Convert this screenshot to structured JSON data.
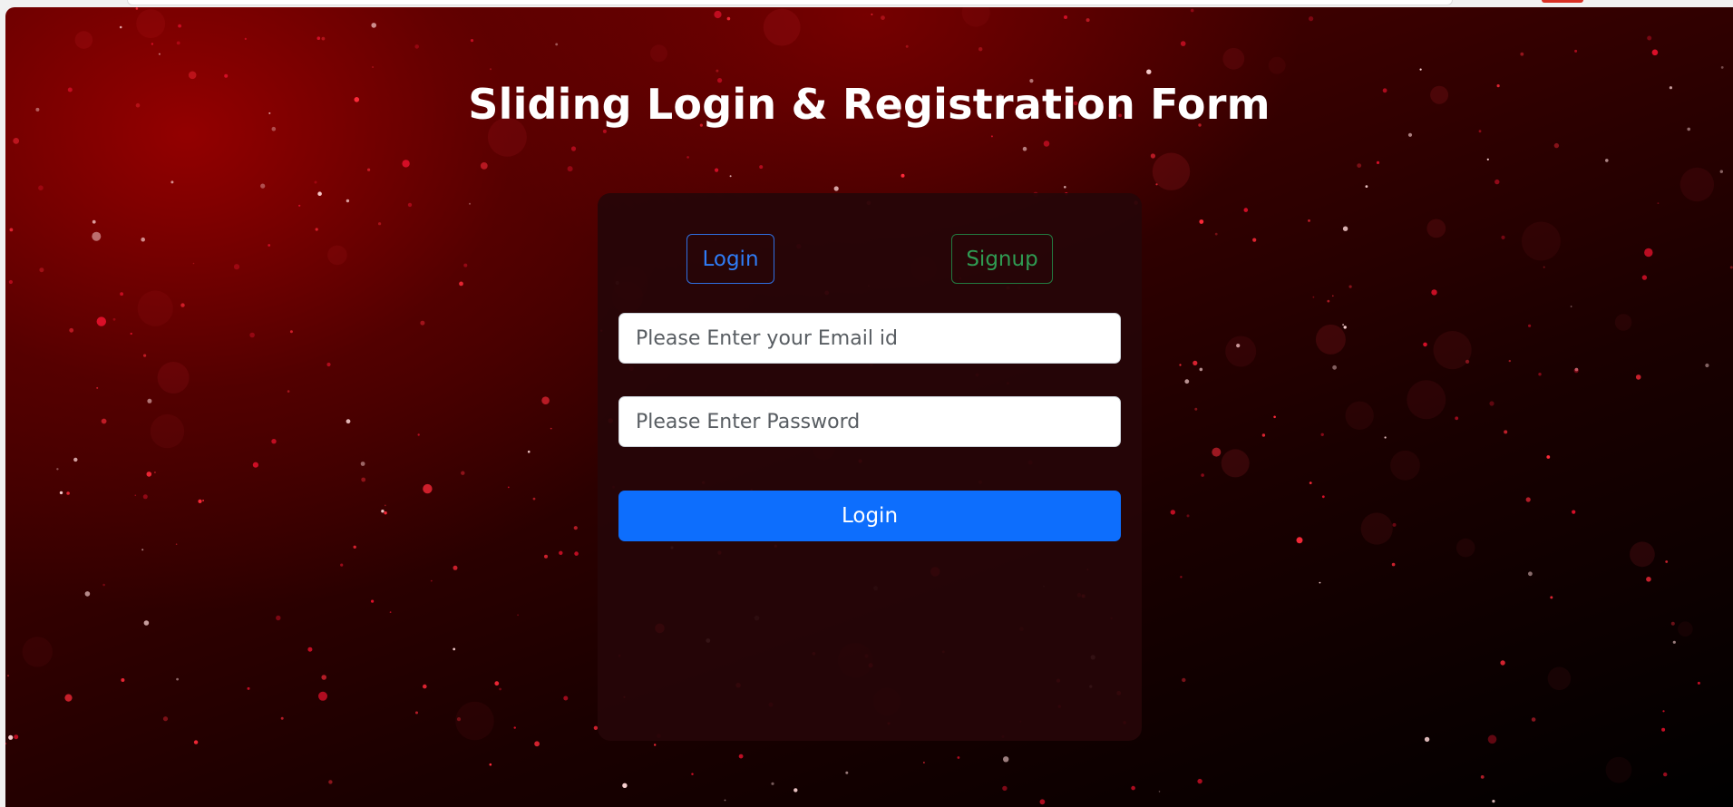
{
  "page": {
    "title": "Sliding Login & Registration Form"
  },
  "tabs": {
    "login_label": "Login",
    "signup_label": "Signup",
    "active": "login"
  },
  "form": {
    "email_placeholder": "Please Enter your Email id",
    "email_value": "",
    "password_placeholder": "Please Enter Password",
    "password_value": "",
    "submit_label": "Login"
  },
  "colors": {
    "primary": "#0d6efd",
    "success": "#198754",
    "card_background": "#260507",
    "page_background": "#3a0000"
  }
}
